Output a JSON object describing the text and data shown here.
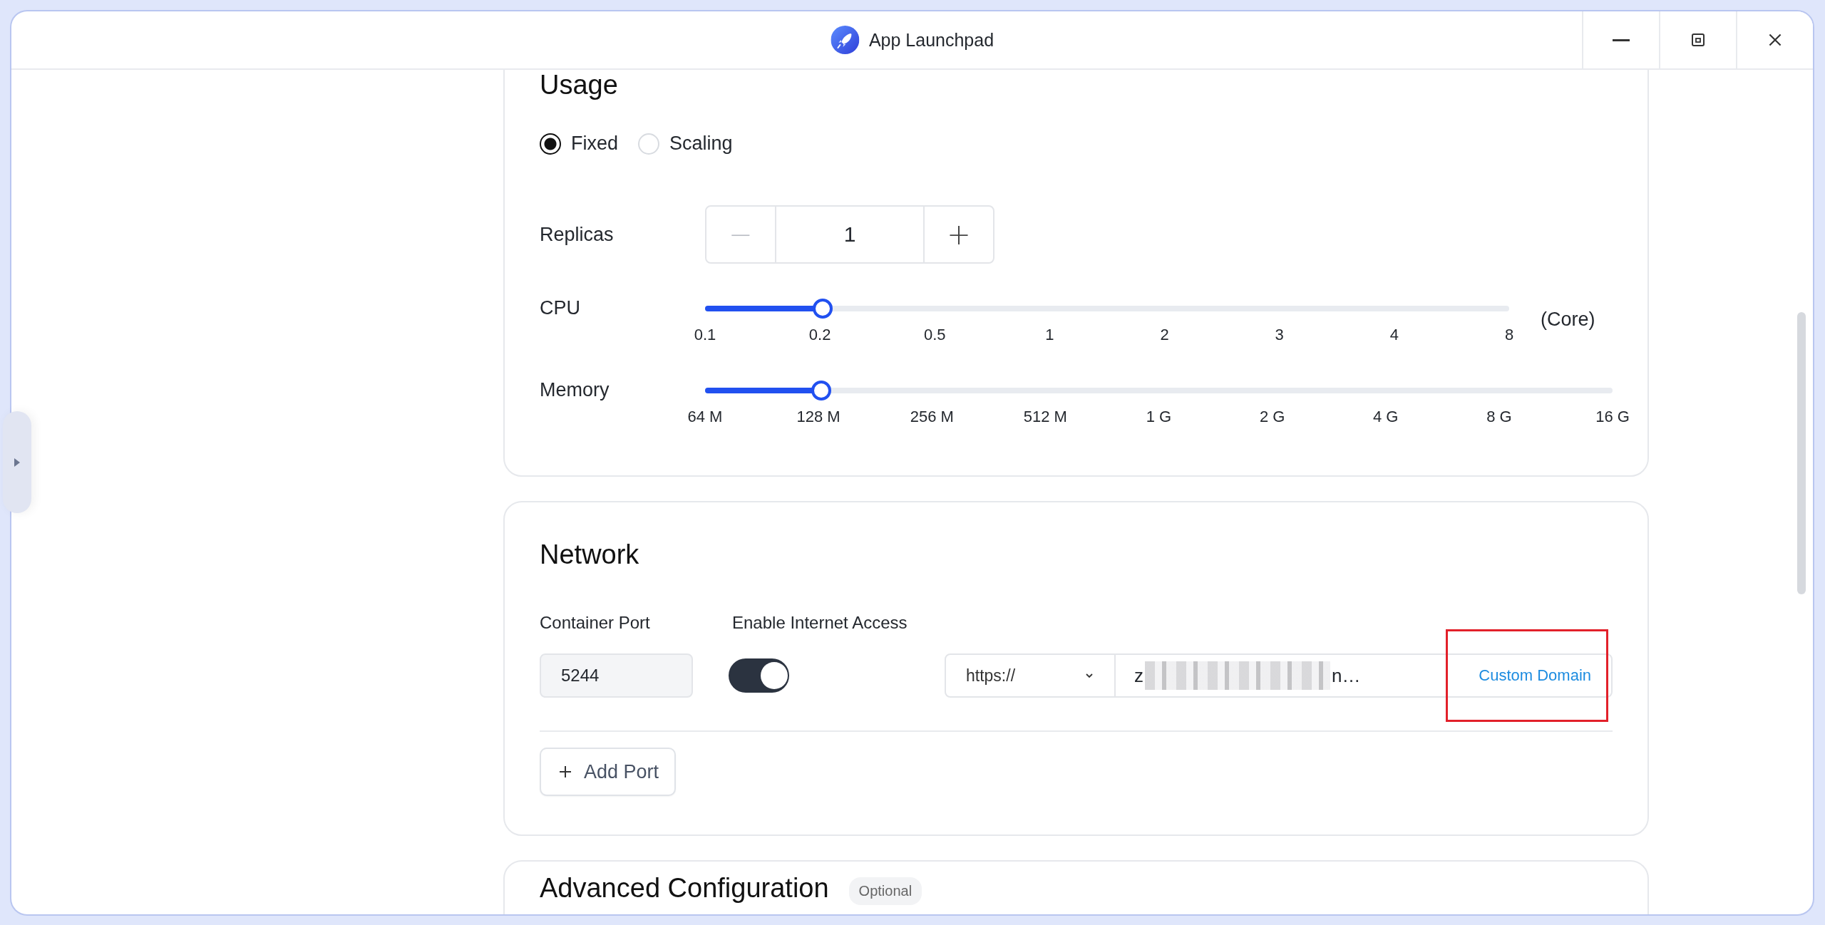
{
  "window": {
    "title": "App Launchpad"
  },
  "usage": {
    "title": "Usage",
    "modes": [
      {
        "label": "Fixed",
        "selected": true
      },
      {
        "label": "Scaling",
        "selected": false
      }
    ],
    "replicas": {
      "label": "Replicas",
      "minus": "−",
      "value": "1",
      "plus": "+"
    },
    "sliders": [
      {
        "label": "CPU",
        "level": 0.143,
        "ticks": [
          "0.1",
          "0.2",
          "0.5",
          "1",
          "2",
          "3",
          "4",
          "8"
        ],
        "unit": "(Core)"
      },
      {
        "label": "Memory",
        "level": 0.125,
        "ticks": [
          "64 M",
          "128 M",
          "256 M",
          "512 M",
          "1 G",
          "2 G",
          "4 G",
          "8 G",
          "16 G"
        ]
      }
    ]
  },
  "network": {
    "title": "Network",
    "container_port": {
      "label": "Container Port",
      "value": "5244"
    },
    "internet_access": {
      "label": "Enable Internet Access",
      "on": true
    },
    "protocol": {
      "value": "https://"
    },
    "domain": {
      "start": "z",
      "end": "n…"
    },
    "custom_domain": {
      "label": "Custom Domain",
      "highlighted": true
    },
    "add_port": {
      "label": "Add Port"
    }
  },
  "advanced": {
    "title": "Advanced Configuration",
    "badge": "Optional"
  }
}
